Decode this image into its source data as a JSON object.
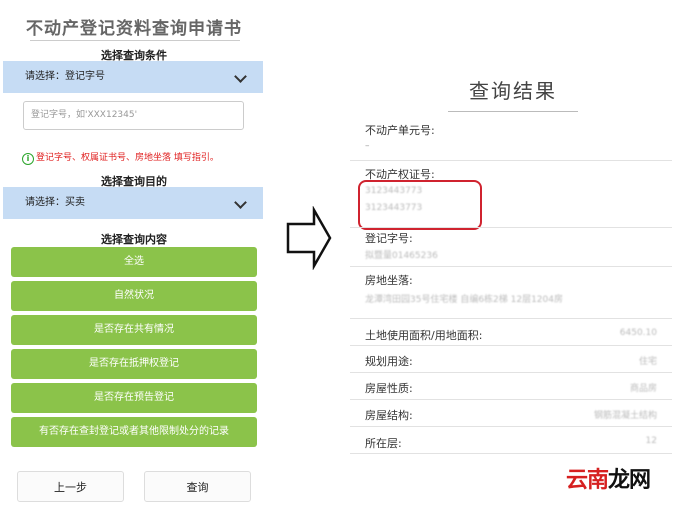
{
  "form": {
    "title": "不动产登记资料查询申请书",
    "condition_label": "选择查询条件",
    "condition_select": "请选择：登记字号",
    "input_placeholder": "登记字号，如'XXX12345'",
    "hint": "登记字号、权属证书号、房地坐落 填写指引。",
    "purpose_label": "选择查询目的",
    "purpose_select": "请选择：买卖",
    "content_label": "选择查询内容",
    "buttons": [
      "全选",
      "自然状况",
      "是否存在共有情况",
      "是否存在抵押权登记",
      "是否存在预告登记",
      "有否存在查封登记或者其他限制处分的记录"
    ],
    "prev_button": "上一步",
    "query_button": "查询"
  },
  "result": {
    "title": "查询结果",
    "unit_no_label": "不动产单元号:",
    "unit_no_value": "–",
    "cert_label": "不动产权证号:",
    "cert_values": [
      "3123443773",
      "3123443773"
    ],
    "reg_label": "登记字号:",
    "reg_value": "拟暨量01465236",
    "address_label": "房地坐落:",
    "address_value": "龙潭湾田园35号住宅楼 自编6栋2梯 12层1204房",
    "rows": [
      {
        "label": "土地使用面积/用地面积:",
        "value": "6450.10"
      },
      {
        "label": "规划用途:",
        "value": "住宅"
      },
      {
        "label": "房屋性质:",
        "value": "商品房"
      },
      {
        "label": "房屋结构:",
        "value": "钢筋混凝土结构"
      },
      {
        "label": "所在层:",
        "value": "12"
      }
    ]
  },
  "watermark": {
    "part1": "云南",
    "part2": "龙网"
  },
  "colors": {
    "accent_green": "#8bc34a",
    "select_blue": "#c6dcf4",
    "highlight_red": "#d0232f"
  }
}
